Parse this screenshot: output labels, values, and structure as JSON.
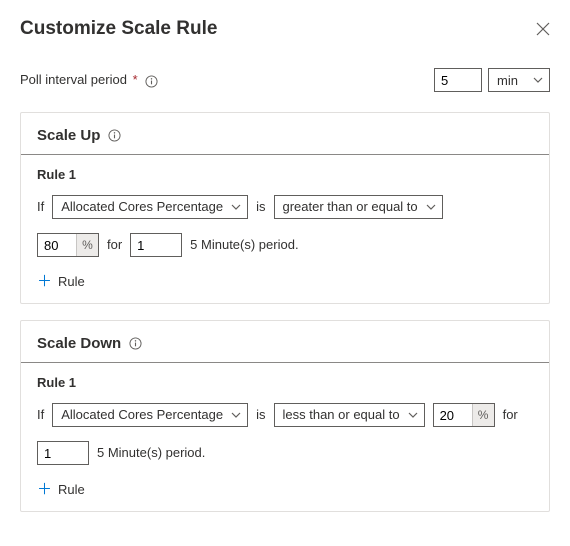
{
  "header": {
    "title": "Customize Scale Rule"
  },
  "interval": {
    "label": "Poll interval period",
    "required_mark": "*",
    "value": "5",
    "unit": "min"
  },
  "scale_up": {
    "heading": "Scale Up",
    "rule_label": "Rule 1",
    "if_text": "If",
    "metric": "Allocated Cores Percentage",
    "is_text": "is",
    "operator": "greater than or equal to",
    "threshold": "80",
    "pct_suffix": "%",
    "for_text": "for",
    "duration": "1",
    "period_text": "5 Minute(s) period.",
    "add_rule": "Rule"
  },
  "scale_down": {
    "heading": "Scale Down",
    "rule_label": "Rule 1",
    "if_text": "If",
    "metric": "Allocated Cores Percentage",
    "is_text": "is",
    "operator": "less than or equal to",
    "threshold": "20",
    "pct_suffix": "%",
    "for_text": "for",
    "duration": "1",
    "period_text": "5 Minute(s) period.",
    "add_rule": "Rule"
  }
}
